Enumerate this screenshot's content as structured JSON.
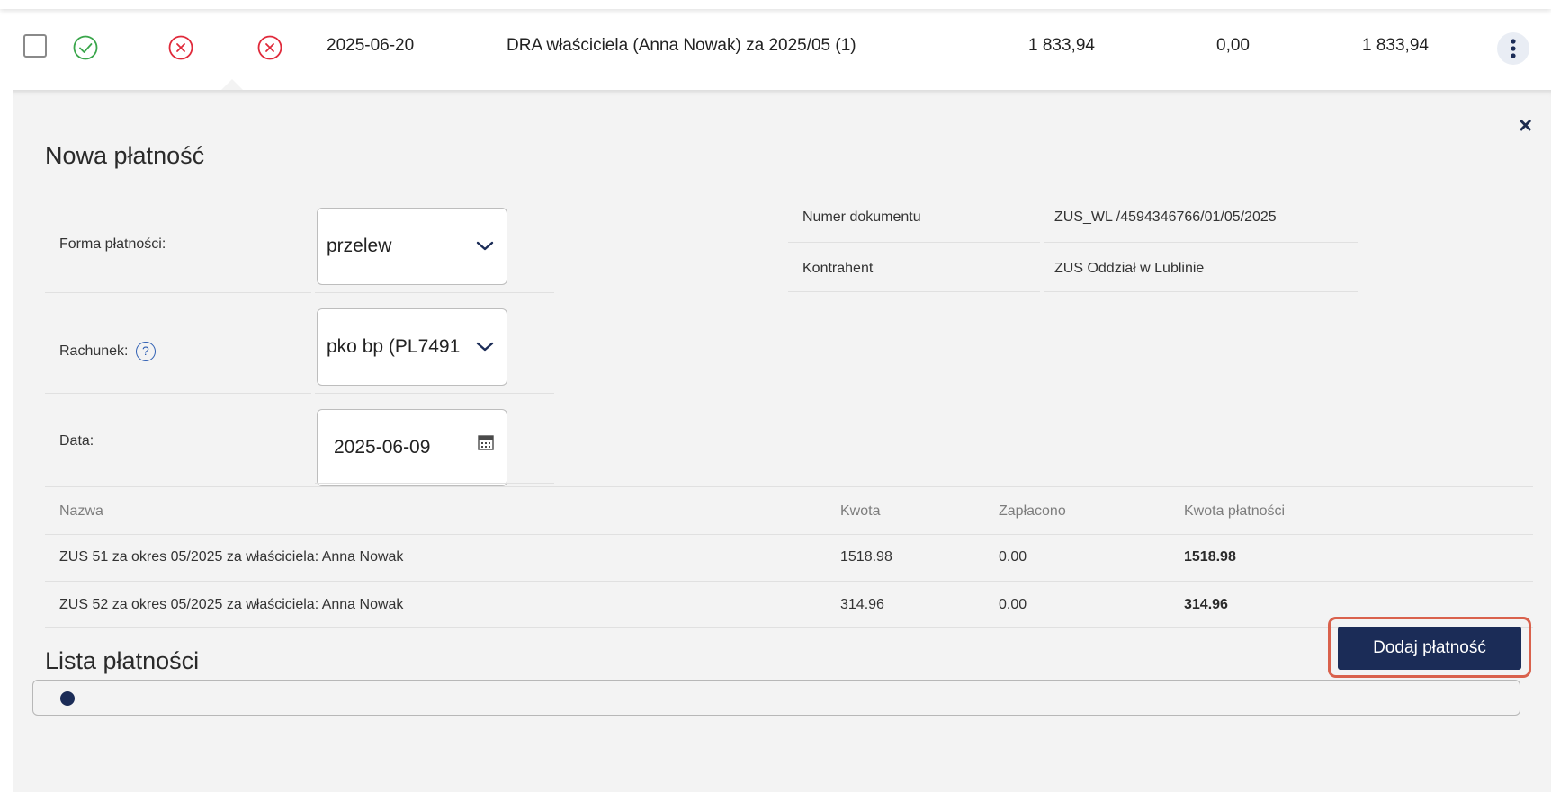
{
  "document_row": {
    "date": "2025-06-20",
    "description": "DRA właściciela (Anna Nowak) za 2025/05 (1)",
    "amount": "1 833,94",
    "paid": "0,00",
    "remaining": "1 833,94"
  },
  "panel": {
    "title": "Nowa płatność",
    "close_label": "×",
    "form": {
      "payment_method_label": "Forma płatności:",
      "payment_method_value": "przelew",
      "account_label": "Rachunek:",
      "account_help": "?",
      "account_value": "pko bp (PL7491",
      "date_label": "Data:",
      "date_value": "2025-06-09"
    },
    "info": {
      "doc_number_label": "Numer dokumentu",
      "doc_number_value": "ZUS_WL /4594346766/01/05/2025",
      "contractor_label": "Kontrahent",
      "contractor_value": "ZUS Oddział w Lublinie"
    },
    "table": {
      "headers": [
        "Nazwa",
        "Kwota",
        "Zapłacono",
        "Kwota płatności"
      ],
      "rows": [
        {
          "name": "ZUS 51 za okres 05/2025 za właściciela: Anna Nowak",
          "amount": "1518.98",
          "paid": "0.00",
          "payment": "1518.98"
        },
        {
          "name": "ZUS 52 za okres 05/2025 za właściciela: Anna Nowak",
          "amount": "314.96",
          "paid": "0.00",
          "payment": "314.96"
        }
      ]
    },
    "list_title": "Lista płatności",
    "add_payment_label": "Dodaj płatność"
  },
  "colors": {
    "ok_green": "#3aa64b",
    "error_red": "#e0293a",
    "navy": "#1b2c57",
    "highlight": "#d9614c"
  },
  "icons": {
    "status_1": "check-circle-icon",
    "status_2": "x-circle-icon",
    "status_3": "x-circle-icon",
    "menu": "kebab-menu-icon",
    "chevron": "chevron-down-icon",
    "calendar": "calendar-icon"
  }
}
